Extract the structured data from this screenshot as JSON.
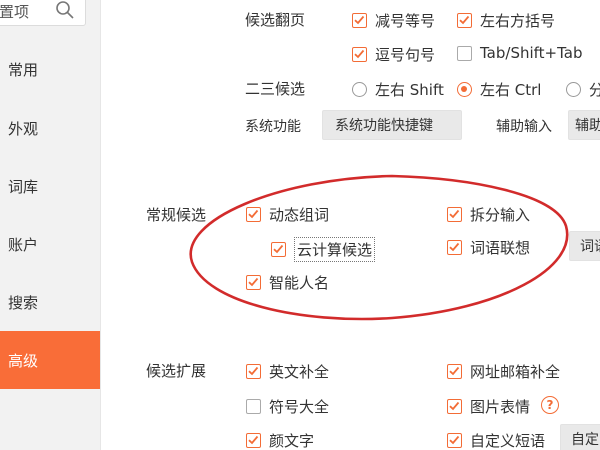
{
  "sidebar": {
    "search_placeholder": "置项",
    "items": [
      {
        "label": "常用"
      },
      {
        "label": "外观"
      },
      {
        "label": "词库"
      },
      {
        "label": "账户"
      },
      {
        "label": "搜索"
      },
      {
        "label": "高级",
        "active": true
      }
    ]
  },
  "candidate_paging": {
    "label": "候选翻页",
    "options": [
      {
        "label": "减号等号",
        "checked": true
      },
      {
        "label": "左右方括号",
        "checked": true
      },
      {
        "label": "逗号句号",
        "checked": true
      },
      {
        "label": "Tab/Shift+Tab",
        "checked": false
      }
    ]
  },
  "second_third_candidate": {
    "label": "二三候选",
    "options": [
      {
        "label": "左右 Shift",
        "selected": false
      },
      {
        "label": "左右 Ctrl",
        "selected": true
      },
      {
        "label": "分",
        "selected": false
      }
    ]
  },
  "system_function": {
    "label": "系统功能",
    "button": "系统功能快捷键",
    "aux_label": "辅助输入",
    "aux_button": "辅助"
  },
  "general_candidate": {
    "label": "常规候选",
    "options": [
      {
        "label": "动态组词",
        "checked": true
      },
      {
        "label": "拆分输入",
        "checked": true
      },
      {
        "label": "云计算候选",
        "checked": true
      },
      {
        "label": "词语联想",
        "checked": true
      },
      {
        "label": "智能人名",
        "checked": true
      }
    ],
    "button": "词语"
  },
  "candidate_extension": {
    "label": "候选扩展",
    "options": [
      {
        "label": "英文补全",
        "checked": true
      },
      {
        "label": "网址邮箱补全",
        "checked": true
      },
      {
        "label": "符号大全",
        "checked": false
      },
      {
        "label": "图片表情",
        "checked": true
      },
      {
        "label": "颜文字",
        "checked": true
      },
      {
        "label": "自定义短语",
        "checked": true
      }
    ],
    "button": "自定",
    "help_icon": "?"
  },
  "colors": {
    "accent": "#f36c36",
    "active_nav": "#f96d38",
    "annotation": "#d02020"
  }
}
